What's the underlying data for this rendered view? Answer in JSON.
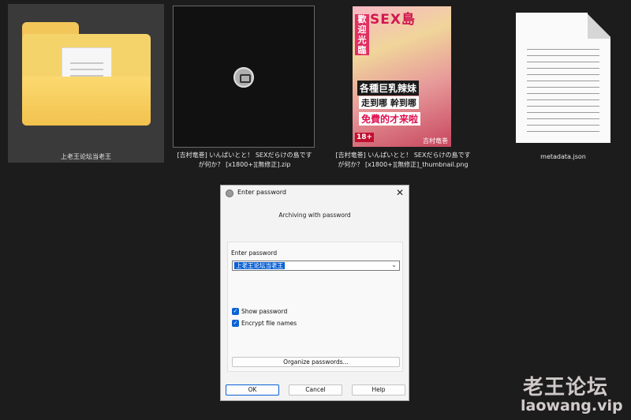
{
  "files": [
    {
      "label": "上老王论坛当老王",
      "selected": true,
      "icon": "folder-icon"
    },
    {
      "label_lines": [
        "[吉村竜巻] いんばいとと！ SEXだらけの島です",
        "が何か？ [x1800+][無修正].zip"
      ],
      "icon": "zip-icon"
    },
    {
      "label_lines": [
        "[吉村竜巻] いんぱいとと！ SEXだらけの島です",
        "が何か？ [x1800+][無修正]_thumbnail.png"
      ],
      "icon": "image-thumbnail"
    },
    {
      "label": "metadata.json",
      "icon": "document-icon"
    }
  ],
  "cover": {
    "title": "SEX島",
    "side": "歡迎光臨",
    "band": "各種巨乳辣妹",
    "mid": "走到哪 幹到哪",
    "sub": "免費的才来啦",
    "age": "18+",
    "author": "吉村竜巻"
  },
  "dialog": {
    "title": "Enter password",
    "subtitle": "Archiving with password",
    "password_label": "Enter password",
    "password_value": "上老王论坛当老王",
    "show_password": {
      "label": "Show password",
      "checked": true
    },
    "encrypt_names": {
      "label": "Encrypt file names",
      "checked": true
    },
    "organize_label": "Organize passwords...",
    "ok_label": "OK",
    "cancel_label": "Cancel",
    "help_label": "Help"
  },
  "watermark": {
    "title": "老王论坛",
    "url": "laowang.vip"
  },
  "colors": {
    "background": "#1c1c1c",
    "accent": "#0a62d6",
    "folder": "#f5d36b"
  }
}
